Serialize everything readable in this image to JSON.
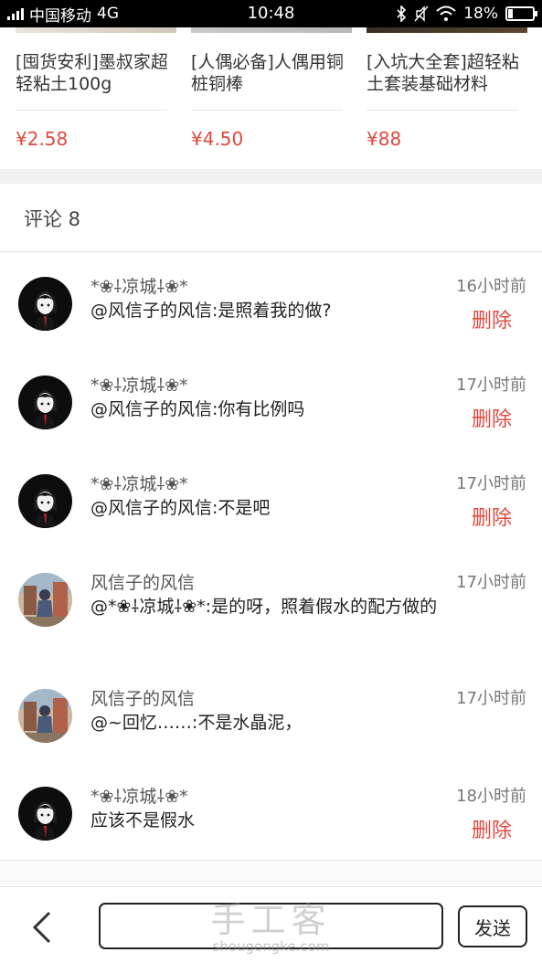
{
  "status_bar": {
    "carrier": "中国移动",
    "network": "4G",
    "time": "10:48",
    "battery": "18%",
    "battery_level": 0.18
  },
  "products": [
    {
      "title": "[囤货安利]墨叔家超轻粘土100g",
      "price": "¥2.58"
    },
    {
      "title": "[人偶必备]人偶用铜桩铜棒",
      "price": "¥4.50"
    },
    {
      "title": "[入坑大全套]超轻粘土套装基础材料",
      "price": "¥88"
    }
  ],
  "comments_header": "评论 8",
  "comments": [
    {
      "name": "*❀⸸凉城⸸❀*",
      "text": "@风信子的风信:是照着我的做?",
      "time": "16小时前",
      "delete": "删除",
      "avatar": "dark"
    },
    {
      "name": "*❀⸸凉城⸸❀*",
      "text": "@风信子的风信:你有比例吗",
      "time": "17小时前",
      "delete": "删除",
      "avatar": "dark"
    },
    {
      "name": "*❀⸸凉城⸸❀*",
      "text": "@风信子的风信:不是吧",
      "time": "17小时前",
      "delete": "删除",
      "avatar": "dark"
    },
    {
      "name": "风信子的风信",
      "text": "@*❀⸸凉城⸸❀*:是的呀，照着假水的配方做的",
      "time": "17小时前",
      "delete": "",
      "avatar": "photo"
    },
    {
      "name": "风信子的风信",
      "text": "@~回忆……:不是水晶泥，",
      "time": "17小时前",
      "delete": "",
      "avatar": "photo"
    },
    {
      "name": "*❀⸸凉城⸸❀*",
      "text": "应该不是假水",
      "time": "18小时前",
      "delete": "删除",
      "avatar": "dark"
    }
  ],
  "bottom_bar": {
    "input_value": "",
    "send_label": "发送",
    "watermark_main": "手工客",
    "watermark_sub": "shougongke.com"
  },
  "colors": {
    "price": "#e0483e",
    "delete": "#e0483e"
  }
}
